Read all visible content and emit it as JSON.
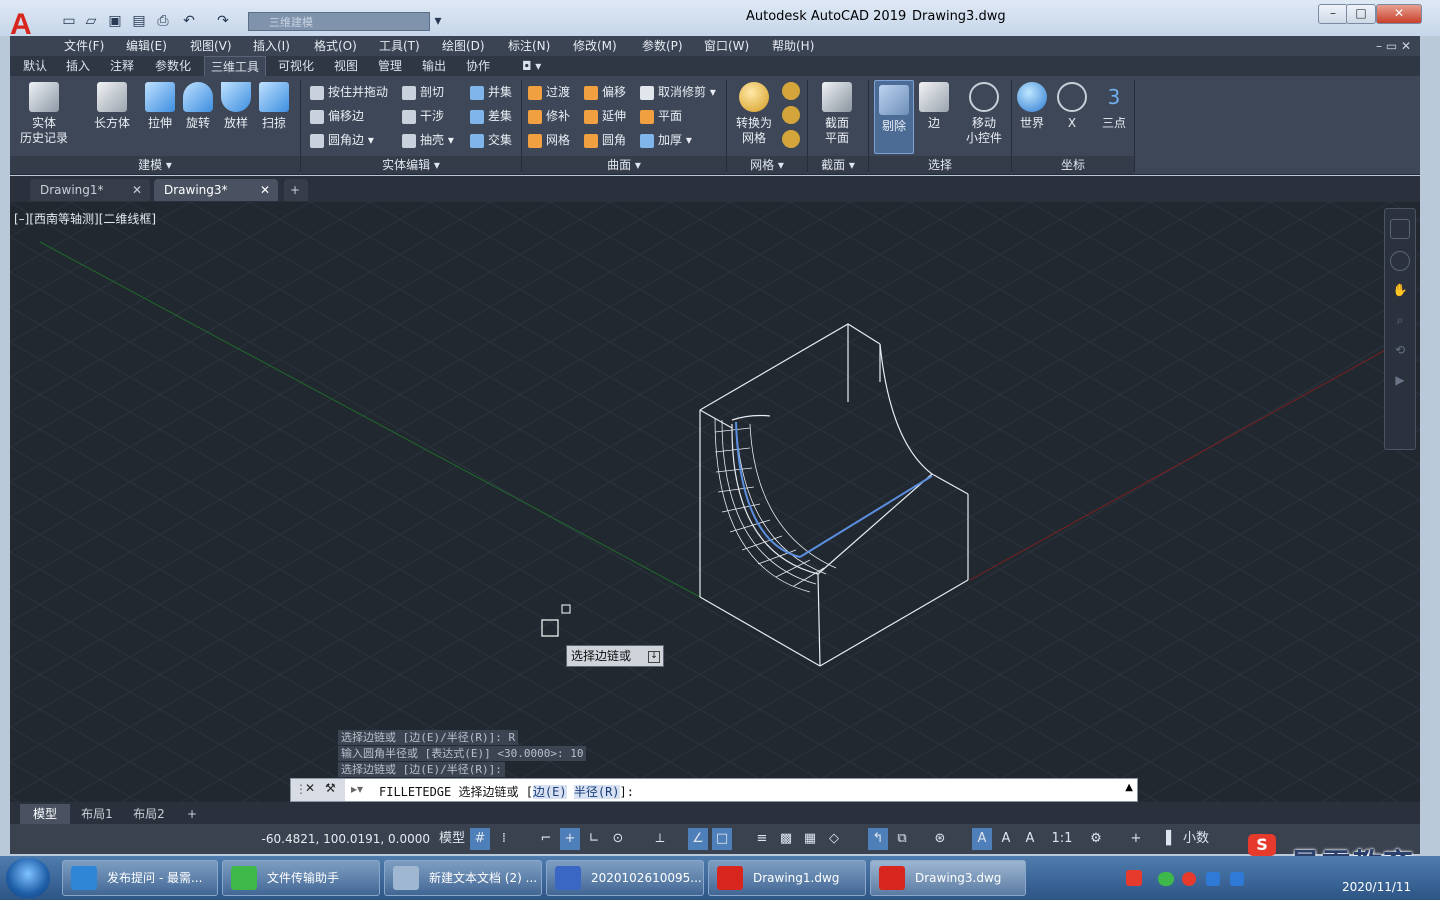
{
  "window": {
    "app_title": "Autodesk AutoCAD 2019",
    "doc_title": "Drawing3.dwg",
    "workspace": "三维建模",
    "app_logo": "A",
    "controls": {
      "minimize": "–",
      "maximize": "□",
      "close": "✕"
    }
  },
  "menubar": [
    "文件(F)",
    "编辑(E)",
    "视图(V)",
    "插入(I)",
    "格式(O)",
    "工具(T)",
    "绘图(D)",
    "标注(N)",
    "修改(M)",
    "参数(P)",
    "窗口(W)",
    "帮助(H)"
  ],
  "ribbon_tabs": [
    "默认",
    "插入",
    "注释",
    "参数化",
    "三维工具",
    "可视化",
    "视图",
    "管理",
    "输出",
    "协作"
  ],
  "active_ribbon_tab": "三维工具",
  "ribbon": {
    "modeling": {
      "title": "建模",
      "buttons": [
        "实体\n历史记录",
        "长方体",
        "拉伸",
        "旋转",
        "放样",
        "扫掠"
      ]
    },
    "solid_edit": {
      "title": "实体编辑",
      "buttons": [
        "按住并拖动",
        "偏移边",
        "圆角边",
        "剖切",
        "干涉",
        "抽壳",
        "并集",
        "差集",
        "交集"
      ]
    },
    "surface": {
      "title": "曲面",
      "buttons": [
        "过渡",
        "修补",
        "网格",
        "偏移",
        "延伸",
        "圆角",
        "取消修剪",
        "平面",
        "加厚"
      ]
    },
    "mesh": {
      "title": "网格",
      "buttons": [
        "转换为\n网格"
      ]
    },
    "section": {
      "title": "截面",
      "buttons": [
        "截面\n平面"
      ]
    },
    "selection": {
      "title": "选择",
      "buttons": [
        "剔除",
        "边",
        "移动\n小控件"
      ]
    },
    "coordinates": {
      "title": "坐标",
      "buttons": [
        "世界",
        "X",
        "三点"
      ]
    }
  },
  "doc_tabs": [
    {
      "label": "Drawing1*",
      "active": false
    },
    {
      "label": "Drawing3*",
      "active": true
    }
  ],
  "viewport_label": "[–][西南等轴测][二维线框]",
  "tooltip": "选择边链或",
  "command_history": [
    "选择边链或 [边(E)/半径(R)]: R",
    "输入圆角半径或 [表达式(E)] <30.0000>: 10",
    "选择边链或 [边(E)/半径(R)]:"
  ],
  "command_line": {
    "prefix": "FILLETEDGE 选择边链或 [",
    "opt1": "边(E)",
    "opt2": "半径(R)",
    "suffix": "]:"
  },
  "layout_tabs": [
    "模型",
    "布局1",
    "布局2"
  ],
  "status": {
    "coords": "-60.4821, 100.0191, 0.0000",
    "model": "模型",
    "scale": "1:1",
    "units": "小数"
  },
  "taskbar": [
    {
      "label": "发布提问 - 最需...",
      "color": "#2f86d6"
    },
    {
      "label": "文件传输助手",
      "color": "#3fb84a"
    },
    {
      "label": "新建文本文档 (2) ...",
      "color": "#9fb7d0"
    },
    {
      "label": "2020102610095...",
      "color": "#3a66c4"
    },
    {
      "label": "Drawing1.dwg",
      "color": "#d8261f"
    },
    {
      "label": "Drawing3.dwg",
      "color": "#d8261f"
    }
  ],
  "clock": {
    "date": "2020/11/11"
  },
  "watermark": "最需教育",
  "colors": {
    "viewport": "#212830",
    "ribbon": "#3e4757",
    "accent": "#d8261f",
    "selected_edge": "#5b8fe0"
  }
}
